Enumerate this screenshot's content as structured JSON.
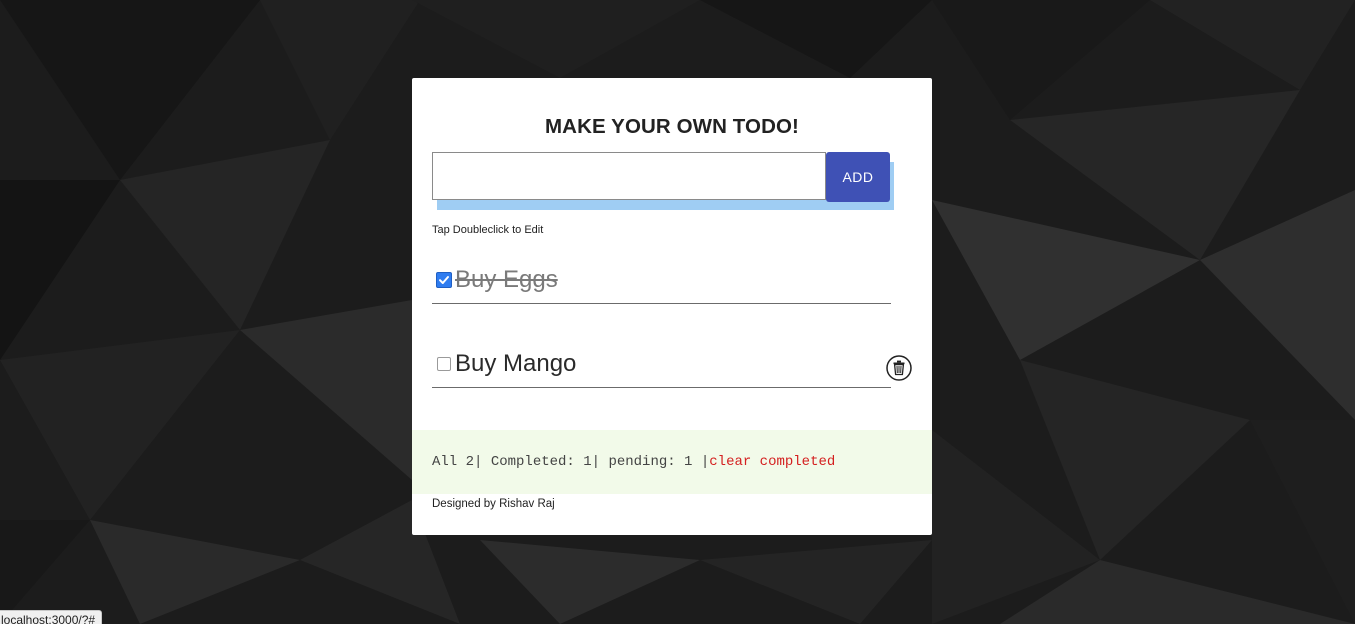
{
  "app": {
    "title": "MAKE YOUR OWN TODO!",
    "hint": "Tap Doubleclick to Edit",
    "credit": "Designed by Rishav Raj"
  },
  "form": {
    "input_value": "",
    "input_placeholder": "",
    "add_label": "ADD"
  },
  "todos": [
    {
      "text": "Buy Eggs",
      "completed": true
    },
    {
      "text": "Buy Mango",
      "completed": false
    }
  ],
  "footer": {
    "all_label": "All 2|",
    "completed_label": " Completed: 1|",
    "pending_label": " pending: 1 |",
    "clear_label": "clear completed"
  },
  "status_bar": {
    "url": "localhost:3000/?#"
  },
  "icons": {
    "checkbox_checked": "checkbox-checked-icon",
    "trash": "trash-icon"
  },
  "colors": {
    "accent": "#3f51b5",
    "input_shadow": "#9fcdf3",
    "checkbox": "#2f7cf0",
    "clear_link": "#d41f1f",
    "footer_bg": "#f2fae9",
    "background": "#1b1b1b"
  }
}
